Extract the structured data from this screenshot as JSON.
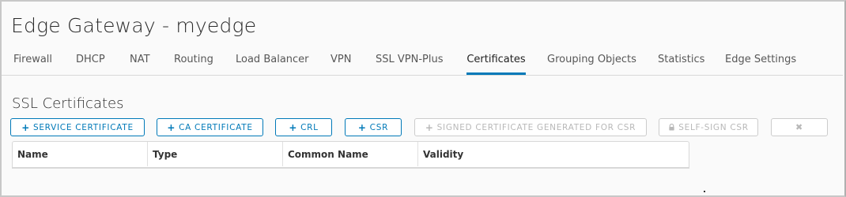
{
  "window": {
    "title": "Edge Gateway - myedge"
  },
  "tabs": [
    {
      "label": "Firewall"
    },
    {
      "label": "DHCP"
    },
    {
      "label": "NAT"
    },
    {
      "label": "Routing"
    },
    {
      "label": "Load Balancer"
    },
    {
      "label": "VPN"
    },
    {
      "label": "SSL VPN-Plus"
    },
    {
      "label": "Certificates",
      "active": true
    },
    {
      "label": "Grouping Objects"
    },
    {
      "label": "Statistics"
    },
    {
      "label": "Edge Settings"
    }
  ],
  "section": {
    "title": "SSL Certificates"
  },
  "toolbar": {
    "service_certificate": {
      "icon": "plus-icon",
      "label": "SERVICE CERTIFICATE"
    },
    "ca_certificate": {
      "icon": "plus-icon",
      "label": "CA CERTIFICATE"
    },
    "crl": {
      "icon": "plus-icon",
      "label": "CRL"
    },
    "csr": {
      "icon": "plus-icon",
      "label": "CSR"
    },
    "signed_certificate": {
      "icon": "plus-icon",
      "label": "SIGNED CERTIFICATE GENERATED FOR CSR",
      "enabled": false
    },
    "self_sign_csr": {
      "icon": "lock-icon",
      "label": "SELF-SIGN CSR",
      "enabled": false
    },
    "delete": {
      "icon": "close-icon",
      "enabled": false
    }
  },
  "table": {
    "columns": [
      {
        "label": "Name"
      },
      {
        "label": "Type"
      },
      {
        "label": "Common Name"
      },
      {
        "label": "Validity"
      }
    ],
    "rows": []
  },
  "colors": {
    "accent": "#0079b8",
    "disabled": "#b8b8b8",
    "background": "#fafafa"
  }
}
